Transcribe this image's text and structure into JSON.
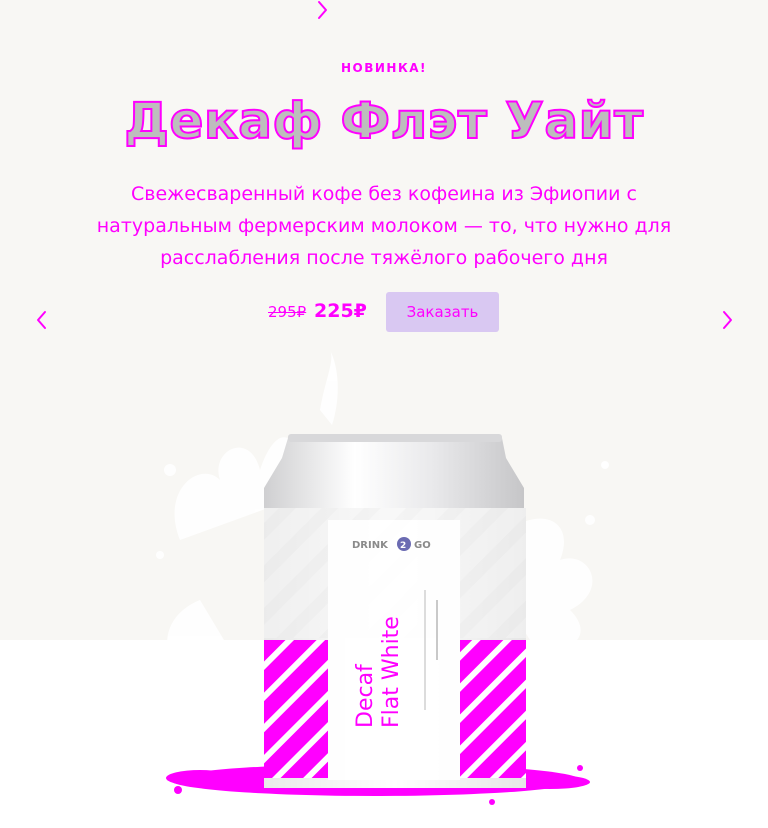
{
  "hero": {
    "badge": "НОВИНКА!",
    "title": "Декаф Флэт Уайт",
    "description": "Свежесваренный кофе без кофеина из Эфиопии с натуральным фермерским молоком — то, что нужно для расслабления после тяжёлого рабочего дня",
    "old_price": "295₽",
    "new_price": "225₽",
    "order_label": "Заказать"
  },
  "product": {
    "brand_left": "DRINK",
    "brand_mid": "2",
    "brand_right": "GO",
    "name_line1": "Decaf",
    "name_line2": "Flat White"
  },
  "icons": {
    "top": "chevron-right-icon",
    "prev": "chevron-left-icon",
    "next": "chevron-right-icon"
  },
  "colors": {
    "background": "#f8f7f4",
    "accent": "#ff00ff",
    "button": "#d9c8f2"
  }
}
